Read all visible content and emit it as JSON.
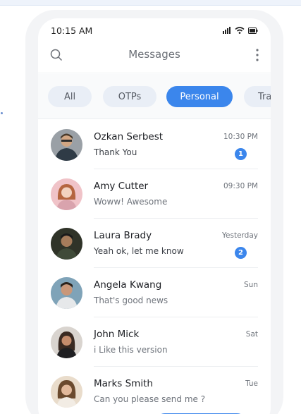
{
  "status_bar": {
    "time": "10:15 AM",
    "icons": [
      "signal-icon",
      "wifi-icon",
      "battery-icon"
    ]
  },
  "header": {
    "title": "Messages",
    "left_icon": "search-icon",
    "right_icon": "more-vertical-icon"
  },
  "filters": {
    "items": [
      {
        "label": "All",
        "active": false
      },
      {
        "label": "OTPs",
        "active": false
      },
      {
        "label": "Personal",
        "active": true
      },
      {
        "label": "Tra",
        "active": false
      }
    ]
  },
  "messages": [
    {
      "name": "Ozkan Serbest",
      "preview": "Thank You",
      "time": "10:30 PM",
      "unread": "1"
    },
    {
      "name": "Amy Cutter",
      "preview": "Woww! Awesome",
      "time": "09:30 PM",
      "unread": ""
    },
    {
      "name": "Laura Brady",
      "preview": "Yeah ok, let me know",
      "time": "Yesterday",
      "unread": "2"
    },
    {
      "name": "Angela Kwang",
      "preview": "That's good news",
      "time": "Sun",
      "unread": ""
    },
    {
      "name": "John Mick",
      "preview": "i Like this version",
      "time": "Sat",
      "unread": ""
    },
    {
      "name": "Marks Smith",
      "preview": "Can you please send me ?",
      "time": "Tue",
      "unread": ""
    }
  ],
  "colors": {
    "accent": "#3b86ec",
    "chip_bg": "#e9eef6",
    "background": "#ffffff"
  }
}
